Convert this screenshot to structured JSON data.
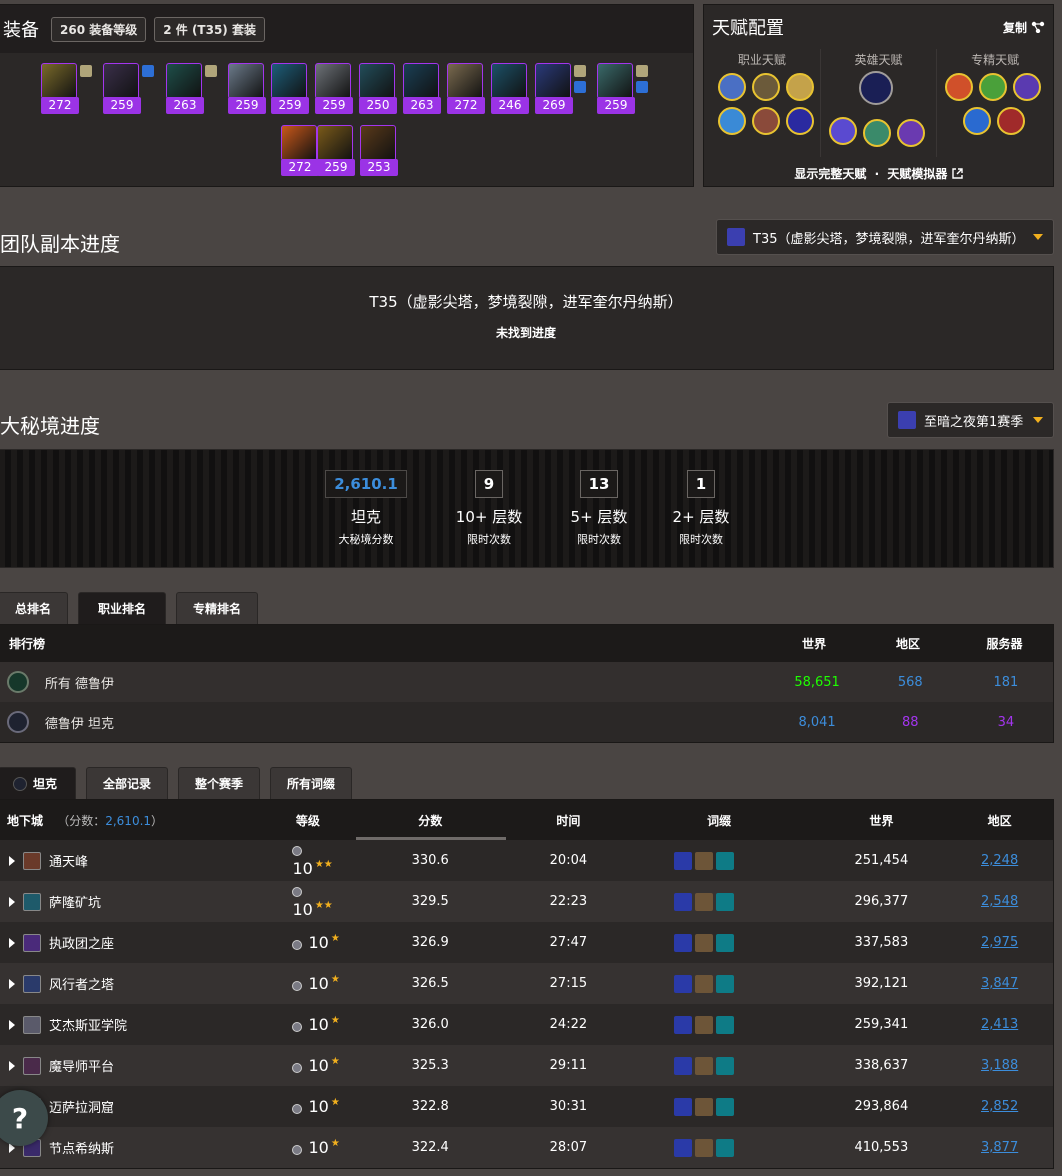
{
  "gear": {
    "title": "装备",
    "item_level_pill": "260 装备等级",
    "set_pill": "2 件 (T35) 套装",
    "items": [
      {
        "ilvl": "272",
        "color": "#7a6a2a"
      },
      {
        "ilvl": "259",
        "color": "#3a2f4a"
      },
      {
        "ilvl": "263",
        "color": "#1e4f4a"
      },
      {
        "ilvl": "259",
        "color": "#6b7a8a"
      },
      {
        "ilvl": "259",
        "color": "#1d5e7a"
      },
      {
        "ilvl": "259",
        "color": "#6d7278"
      },
      {
        "ilvl": "250",
        "color": "#224d5a"
      },
      {
        "ilvl": "263",
        "color": "#1a3f55"
      },
      {
        "ilvl": "272",
        "color": "#7a6a4f"
      },
      {
        "ilvl": "246",
        "color": "#1c5168"
      },
      {
        "ilvl": "269",
        "color": "#2a3a7a"
      },
      {
        "ilvl": "259",
        "color": "#3a6a6a"
      },
      {
        "ilvl": "272",
        "color": "#c9581a"
      },
      {
        "ilvl": "259",
        "color": "#7a5a1a"
      },
      {
        "ilvl": "253",
        "color": "#5a3a1a"
      }
    ]
  },
  "talents": {
    "title": "天赋配置",
    "copy_label": "复制",
    "class_label": "职业天赋",
    "hero_label": "英雄天赋",
    "spec_label": "专精天赋",
    "show_full": "显示完整天赋",
    "separator": "·",
    "simulator": "天赋模拟器"
  },
  "raid": {
    "title": "团队副本进度",
    "selector": "T35（虚影尖塔，梦境裂隙，进军奎尔丹纳斯）",
    "raid_name": "T35（虚影尖塔，梦境裂隙，进军奎尔丹纳斯）",
    "no_progress": "未找到进度"
  },
  "mplus": {
    "title": "大秘境进度",
    "season": "至暗之夜第1赛季",
    "stats": [
      {
        "value": "2,610.1",
        "label": "坦克",
        "sub": "大秘境分数"
      },
      {
        "value": "9",
        "label": "10+ 层数",
        "sub": "限时次数"
      },
      {
        "value": "13",
        "label": "5+ 层数",
        "sub": "限时次数"
      },
      {
        "value": "1",
        "label": "2+ 层数",
        "sub": "限时次数"
      }
    ]
  },
  "rank_tabs": [
    "总排名",
    "职业排名",
    "专精排名"
  ],
  "ranking": {
    "headers": {
      "board": "排行榜",
      "world": "世界",
      "region": "地区",
      "server": "服务器"
    },
    "rows": [
      {
        "name": "所有 德鲁伊",
        "world": "58,651",
        "region": "568",
        "server": "181"
      },
      {
        "name": "德鲁伊 坦克",
        "world": "8,041",
        "region": "88",
        "server": "34"
      }
    ]
  },
  "run_tabs": [
    "坦克",
    "全部记录",
    "整个赛季",
    "所有词缀"
  ],
  "dungeons": {
    "headers": {
      "dungeon": "地下城",
      "score_prefix": "（分数：",
      "score_value": "2,610.1",
      "score_suffix": "）",
      "level": "等级",
      "score": "分数",
      "time": "时间",
      "affix": "词缀",
      "world": "世界",
      "region": "地区"
    },
    "rows": [
      {
        "name": "通天峰",
        "level": "10",
        "stars": "★★",
        "score": "330.6",
        "time": "20:04",
        "world": "251,454",
        "region": "2,248"
      },
      {
        "name": "萨隆矿坑",
        "level": "10",
        "stars": "★★",
        "score": "329.5",
        "time": "22:23",
        "world": "296,377",
        "region": "2,548"
      },
      {
        "name": "执政团之座",
        "level": "10",
        "stars": "★",
        "score": "326.9",
        "time": "27:47",
        "world": "337,583",
        "region": "2,975"
      },
      {
        "name": "风行者之塔",
        "level": "10",
        "stars": "★",
        "score": "326.5",
        "time": "27:15",
        "world": "392,121",
        "region": "3,847"
      },
      {
        "name": "艾杰斯亚学院",
        "level": "10",
        "stars": "★",
        "score": "326.0",
        "time": "24:22",
        "world": "259,341",
        "region": "2,413"
      },
      {
        "name": "魔导师平台",
        "level": "10",
        "stars": "★",
        "score": "325.3",
        "time": "29:11",
        "world": "338,637",
        "region": "3,188"
      },
      {
        "name": "迈萨拉洞窟",
        "level": "10",
        "stars": "★",
        "score": "322.8",
        "time": "30:31",
        "world": "293,864",
        "region": "2,852"
      },
      {
        "name": "节点希纳斯",
        "level": "10",
        "stars": "★",
        "score": "322.4",
        "time": "28:07",
        "world": "410,553",
        "region": "3,877"
      }
    ]
  },
  "help": "?",
  "colors": {
    "epic": "#9b33e6",
    "blue": "#3c8ddb",
    "green": "#1eff00",
    "purple": "#a335ee",
    "gold": "#f2b01e"
  }
}
